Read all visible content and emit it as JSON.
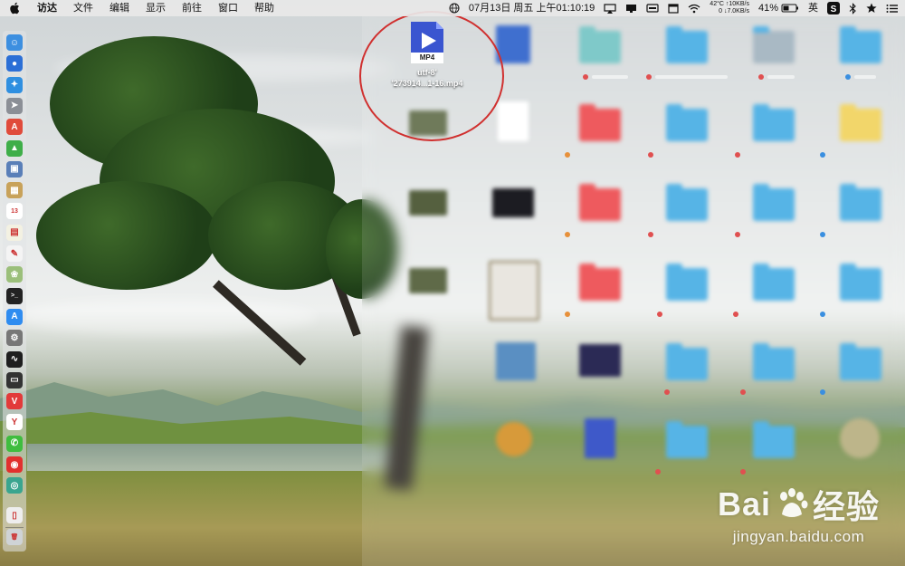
{
  "menubar": {
    "app_name": "访达",
    "menus": [
      "文件",
      "编辑",
      "显示",
      "前往",
      "窗口",
      "帮助"
    ],
    "status": {
      "clock": "07月13日 周五 上午01:10:19",
      "temperature": "42°C",
      "fan": "0",
      "net_up": "↑10KB/s",
      "net_down": "↓7.0KB/s",
      "battery": "41%",
      "input_method": "英"
    }
  },
  "dock": {
    "icons": [
      {
        "name": "finder-icon",
        "color": "#3d8fe0",
        "glyph": "☺"
      },
      {
        "name": "siri-icon",
        "color": "#2b6fd6",
        "glyph": "●"
      },
      {
        "name": "safari-icon",
        "color": "#2f8fe0",
        "glyph": "✦"
      },
      {
        "name": "launchpad-icon",
        "color": "#8b8f96",
        "glyph": "➤"
      },
      {
        "name": "app-red-icon",
        "color": "#e04b3b",
        "glyph": "A"
      },
      {
        "name": "android-icon",
        "color": "#3fae49",
        "glyph": "▲"
      },
      {
        "name": "preview-icon",
        "color": "#5a7fb8",
        "glyph": "▣"
      },
      {
        "name": "notes-icon",
        "color": "#c8a25a",
        "glyph": "▦"
      },
      {
        "name": "calendar-icon",
        "color": "#ffffff",
        "glyph": "13"
      },
      {
        "name": "stickies-icon",
        "color": "#f3f1e2",
        "glyph": "▤"
      },
      {
        "name": "text-edit-icon",
        "color": "#f4f4f4",
        "glyph": "✎"
      },
      {
        "name": "photos-icon",
        "color": "#9bbf7a",
        "glyph": "❀"
      },
      {
        "name": "terminal-icon",
        "color": "#222222",
        "glyph": ">_"
      },
      {
        "name": "app-store-icon",
        "color": "#2f8cf0",
        "glyph": "A"
      },
      {
        "name": "system-preferences-icon",
        "color": "#777777",
        "glyph": "⚙"
      },
      {
        "name": "activity-monitor-icon",
        "color": "#1e1e1e",
        "glyph": "∿"
      },
      {
        "name": "console-icon",
        "color": "#333333",
        "glyph": "▭"
      },
      {
        "name": "vivaldi-icon",
        "color": "#e23a3a",
        "glyph": "V"
      },
      {
        "name": "yandex-icon",
        "color": "#ffffff",
        "glyph": "Y"
      },
      {
        "name": "wechat-icon",
        "color": "#3fbd3f",
        "glyph": "✆"
      },
      {
        "name": "weibo-icon",
        "color": "#e1302e",
        "glyph": "◉"
      },
      {
        "name": "app-green-icon",
        "color": "#3aa58f",
        "glyph": "◎"
      },
      {
        "name": "document-icon",
        "color": "#eeeeee",
        "glyph": "▯"
      },
      {
        "name": "trash-icon",
        "color": "#cfd3d6",
        "glyph": "🗑"
      }
    ]
  },
  "desktop": {
    "highlighted_file": {
      "type_badge": "MP4",
      "line1": "utf-8'",
      "line2": "'273914...1-16.mp4"
    }
  },
  "watermark": {
    "logo_left": "Bai",
    "logo_right": "经验",
    "url": "jingyan.baidu.com"
  }
}
